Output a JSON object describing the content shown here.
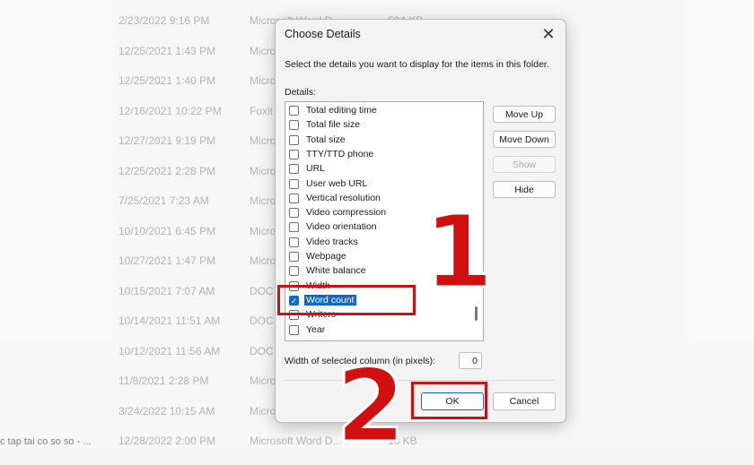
{
  "background": {
    "rows": [
      {
        "date": "2/23/2022 9:16 PM",
        "type": "Microsoft Word D...",
        "size": "594 KB"
      },
      {
        "date": "12/25/2021 1:43 PM",
        "type": "Micro",
        "size": ""
      },
      {
        "date": "12/25/2021 1:40 PM",
        "type": "Micro",
        "size": ""
      },
      {
        "date": "12/16/2021 10:22 PM",
        "type": "Foxit",
        "size": ""
      },
      {
        "date": "12/27/2021 9:19 PM",
        "type": "Micro",
        "size": ""
      },
      {
        "date": "12/25/2021 2:28 PM",
        "type": "Micro",
        "size": ""
      },
      {
        "date": "7/25/2021 7:23 AM",
        "type": "Micro",
        "size": ""
      },
      {
        "date": "10/10/2021 6:45 PM",
        "type": "Micro",
        "size": ""
      },
      {
        "date": "10/27/2021 1:47 PM",
        "type": "Micro",
        "size": ""
      },
      {
        "date": "10/15/2021 7:07 AM",
        "type": "DOC",
        "size": ""
      },
      {
        "date": "10/14/2021 11:51 AM",
        "type": "DOC",
        "size": ""
      },
      {
        "date": "10/12/2021 11:56 AM",
        "type": "DOC",
        "size": ""
      },
      {
        "date": "11/8/2021 2:28 PM",
        "type": "Micro",
        "size": ""
      },
      {
        "date": "3/24/2022 10:15 AM",
        "type": "Micro",
        "size": ""
      },
      {
        "date": "12/28/2022 2:00 PM",
        "type": "Microsoft Word D...",
        "size": "18 KB"
      }
    ],
    "left_fragment": "c tap tai co so so - ..."
  },
  "dialog": {
    "title": "Choose Details",
    "close_glyph": "✕",
    "instruction": "Select the details you want to display for the items in this folder.",
    "details_label": "Details:",
    "items": [
      {
        "label": "Total editing time",
        "checked": false,
        "selected": false
      },
      {
        "label": "Total file size",
        "checked": false,
        "selected": false
      },
      {
        "label": "Total size",
        "checked": false,
        "selected": false
      },
      {
        "label": "TTY/TTD phone",
        "checked": false,
        "selected": false
      },
      {
        "label": "URL",
        "checked": false,
        "selected": false
      },
      {
        "label": "User web URL",
        "checked": false,
        "selected": false
      },
      {
        "label": "Vertical resolution",
        "checked": false,
        "selected": false
      },
      {
        "label": "Video compression",
        "checked": false,
        "selected": false
      },
      {
        "label": "Video orientation",
        "checked": false,
        "selected": false
      },
      {
        "label": "Video tracks",
        "checked": false,
        "selected": false
      },
      {
        "label": "Webpage",
        "checked": false,
        "selected": false
      },
      {
        "label": "White balance",
        "checked": false,
        "selected": false
      },
      {
        "label": "Width",
        "checked": false,
        "selected": false
      },
      {
        "label": "Word count",
        "checked": true,
        "selected": true
      },
      {
        "label": "Writers",
        "checked": false,
        "selected": false
      },
      {
        "label": "Year",
        "checked": false,
        "selected": false
      }
    ],
    "buttons": {
      "move_up": "Move Up",
      "move_down": "Move Down",
      "show": "Show",
      "hide": "Hide",
      "ok": "OK",
      "cancel": "Cancel"
    },
    "width_label": "Width of selected column (in pixels):",
    "width_value": "0"
  },
  "annotations": {
    "step1": "1",
    "step2": "2",
    "color": "#d20f0f"
  },
  "colors": {
    "accent": "#1366c4"
  }
}
